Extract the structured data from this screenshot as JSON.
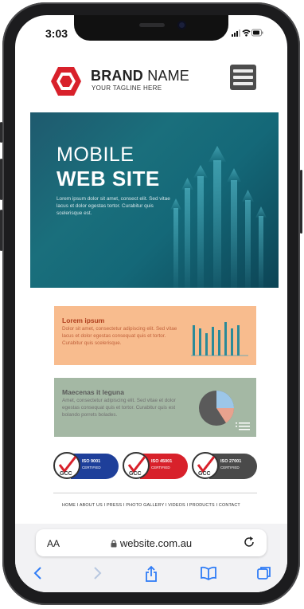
{
  "status": {
    "time": "3:03"
  },
  "brand": {
    "name_bold": "BRAND",
    "name_light": " NAME",
    "tagline": "YOUR TAGLINE HERE"
  },
  "hero": {
    "title_line1": "MOBILE",
    "title_line2": "WEB SITE",
    "body": "Lorem ipsum dolor sit amet, consect elit. Sed vitae lacus et dolor egestas tortor. Curabitur quis scelerisque est."
  },
  "card1": {
    "title": "Lorem ipsum",
    "text": "Dolor sit amet, consectetur adipiscing elit. Sed vitae lacus et dolor egestas consequat quis et tortor. Curabitur quis scelerisque."
  },
  "card2": {
    "title": "Maecenas it leguna",
    "text": "Amet, consectetur adipiscing elit. Sed vitae et dolor egestas consequat quis et tortor. Curabitur quis est bolando porrets bolades."
  },
  "certifications": [
    {
      "code": "ISO 9001",
      "sub": "CERTIFIED",
      "color": "#1e3f9a"
    },
    {
      "code": "ISO 45001",
      "sub": "CERTIFIED",
      "color": "#d8212b"
    },
    {
      "code": "ISO 27001",
      "sub": "CERTIFIED",
      "color": "#4a4a4a"
    }
  ],
  "cert_badge_label": "GCC",
  "footer_nav": [
    "HOME",
    "ABOUT US",
    "PRESS",
    "PHOTO GALLERY",
    "VIDEOS",
    "PRODUCTS",
    "CONTACT"
  ],
  "footer_nav_text": "HOME I ABOUT US I PRESS I PHOTO GALLERY I VIDEOS I PRODUCTS I CONTACT",
  "browser": {
    "text_size_label": "AA",
    "url": "website.com.au"
  },
  "colors": {
    "brand_red": "#d8212b",
    "hero_teal": "#1a6f7c",
    "card1": "#f8bc8e",
    "card2": "#a4b8a4",
    "safari_blue": "#2f7cf6"
  },
  "icons": [
    "signal-icon",
    "wifi-icon",
    "battery-icon",
    "hexagon-logo-icon",
    "hamburger-menu-icon",
    "lock-icon",
    "reload-icon",
    "back-icon",
    "forward-icon",
    "share-icon",
    "bookmarks-icon",
    "tabs-icon"
  ]
}
